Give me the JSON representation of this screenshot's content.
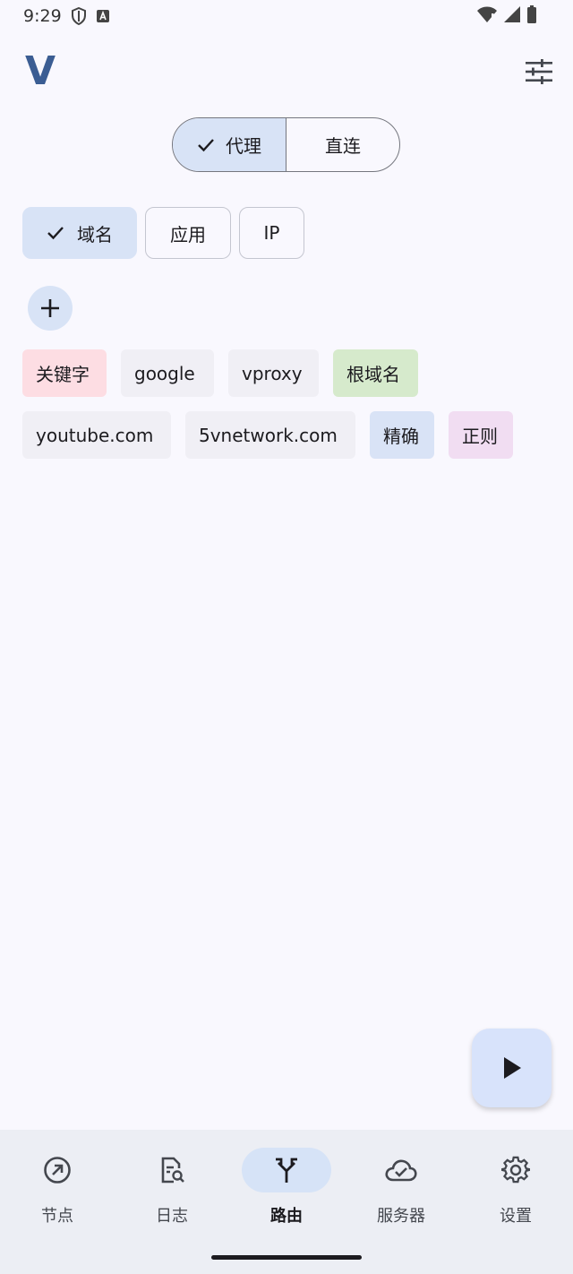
{
  "status_bar": {
    "time": "9:29"
  },
  "app": {
    "logo": "V"
  },
  "mode": {
    "options": [
      "代理",
      "直连"
    ],
    "selected": 0
  },
  "filters": {
    "options": [
      "域名",
      "应用",
      "IP"
    ],
    "selected": 0
  },
  "tags": {
    "row1": [
      "关键字",
      "google",
      "vproxy",
      "根域名"
    ],
    "row2": [
      "youtube.com",
      "5vnetwork.com",
      "精确",
      "正则"
    ]
  },
  "nav": {
    "items": [
      "节点",
      "日志",
      "路由",
      "服务器",
      "设置"
    ],
    "active": 2
  },
  "colors": {
    "accent": "#d8e3f6",
    "logo": "#3b5d93"
  }
}
